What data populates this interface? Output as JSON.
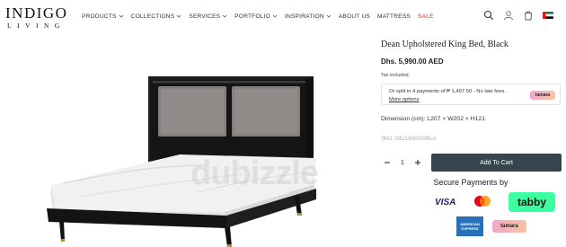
{
  "brand": {
    "logo_main": "INDIGO",
    "logo_sub": "LIVING"
  },
  "nav": {
    "items": [
      {
        "label": "PRODUCTS",
        "dropdown": true,
        "color": "#333333"
      },
      {
        "label": "COLLECTIONS",
        "dropdown": true,
        "color": "#333333"
      },
      {
        "label": "SERVICES",
        "dropdown": true,
        "color": "#333333"
      },
      {
        "label": "PORTFOLIO",
        "dropdown": true,
        "color": "#333333"
      },
      {
        "label": "INSPIRATION",
        "dropdown": true,
        "color": "#333333"
      },
      {
        "label": "ABOUT US",
        "dropdown": false,
        "color": "#333333"
      },
      {
        "label": "MATTRESS",
        "dropdown": false,
        "color": "#333333"
      },
      {
        "label": "SALE",
        "dropdown": false,
        "color": "#c0392b"
      }
    ],
    "icons": [
      "search-icon",
      "account-icon",
      "cart-icon",
      "uae-flag-icon"
    ]
  },
  "image": {
    "watermark": "dubizzle"
  },
  "product": {
    "title": "Dean Upholstered King Bed, Black",
    "price": "Dhs. 5,990.00 AED",
    "tax_note": "Tax included.",
    "installment_text": "Or split in 4 payments of ₱ 1,497.50 - No late fees.",
    "installment_link": "More options",
    "installment_badge": "tamara",
    "dimension": "Dimension (cm): L207 × W202 × H121",
    "sku": "SKU: O62180KNGBLA",
    "quantity": "1",
    "add_to_cart": "Add To Cart"
  },
  "payments": {
    "heading": "Secure Payments by",
    "visa": "VISA",
    "tabby": "tabby",
    "amex_line1": "AMERICAN",
    "amex_line2": "EXPRESS",
    "tamara": "tamara",
    "colors": {
      "visa": "#1a1f71",
      "tabby_bg": "#3bffa0",
      "amex_bg": "#2671b9",
      "button_bg": "#37454f"
    }
  }
}
